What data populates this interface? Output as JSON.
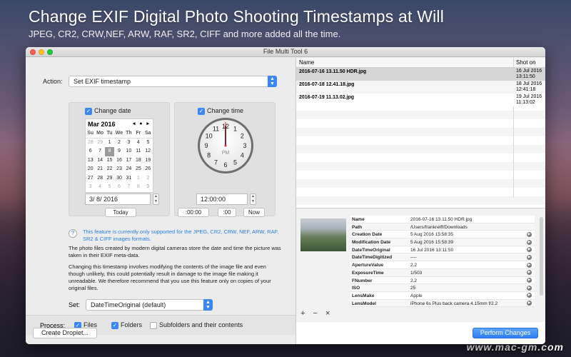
{
  "hero": {
    "title": "Change EXIF Digital Photo Shooting Timestamps at Will",
    "subtitle": "JPEG, CR2, CRW,NEF, ARW, RAF, SR2, CIFF and more added all the time."
  },
  "watermark": "www.mac-gm.com",
  "window": {
    "title": "File Multi Tool 6"
  },
  "action": {
    "label": "Action:",
    "value": "Set EXIF timestamp"
  },
  "date_panel": {
    "checkbox_label": "Change date",
    "month": "Mar 2016",
    "nav": "◂ ● ▸",
    "dow": [
      "Su",
      "Mo",
      "Tu",
      "We",
      "Th",
      "Fr",
      "Sa"
    ],
    "weeks": [
      [
        "28",
        "29",
        "1",
        "2",
        "3",
        "4",
        "5"
      ],
      [
        "6",
        "7",
        "8",
        "9",
        "10",
        "11",
        "12"
      ],
      [
        "13",
        "14",
        "15",
        "16",
        "17",
        "18",
        "19"
      ],
      [
        "20",
        "21",
        "22",
        "23",
        "24",
        "25",
        "26"
      ],
      [
        "27",
        "28",
        "29",
        "30",
        "31",
        "1",
        "2"
      ],
      [
        "3",
        "4",
        "5",
        "6",
        "7",
        "8",
        "9"
      ]
    ],
    "date_value": "3/  8/ 2016",
    "today_button": "Today"
  },
  "time_panel": {
    "checkbox_label": "Change time",
    "clock_numbers": [
      "12",
      "1",
      "2",
      "3",
      "4",
      "5",
      "6",
      "7",
      "8",
      "9",
      "10",
      "11"
    ],
    "pm_label": "PM",
    "time_value": "12:00:00",
    "btn_zero_min": ":00:00",
    "btn_zero_sec": ":00",
    "btn_now": "Now"
  },
  "info": {
    "help_icon": "?",
    "note": "This feature is currently only supported for the JPEG, CR2, CRW, NEF, ARW, RAF, SR2 & CIFF images formats.",
    "para1": "The photo files created by modern digital cameras store the date and time the picture was taken in their EXIF meta-data.",
    "para2": "Changing this timestamp involves modifying the contents of the image file and even though unlikely, this could potentially result in damage to the image file making it unreadable. We therefore recommend that you use this feature only on copies of your original files."
  },
  "set": {
    "label": "Set:",
    "value": "DateTimeOriginal (default)"
  },
  "process": {
    "label": "Process:",
    "files": "Files",
    "folders": "Folders",
    "subfolders": "Subfolders and their contents"
  },
  "buttons": {
    "create_droplet": "Create Droplet...",
    "perform": "Perform Changes"
  },
  "file_list": {
    "col_name": "Name",
    "col_shot": "Shot on",
    "rows": [
      {
        "name": "2016-07-16 13.11.50 HDR.jpg",
        "date": "16 Jul 2016",
        "time": "13:11:50"
      },
      {
        "name": "2016-07-18 12.41.18.jpg",
        "date": "18 Jul 2016",
        "time": "12:41:18"
      },
      {
        "name": "2016-07-19 11.13.02.jpg",
        "date": "19 Jul 2016",
        "time": "11:13:02"
      }
    ]
  },
  "details": {
    "rows": [
      {
        "key": "Name",
        "value": "2016-07-16 13.11.50 HDR.jpg",
        "arrow": false
      },
      {
        "key": "Path",
        "value": "/Users/frankreiff/Downloads",
        "arrow": false
      },
      {
        "key": "Creation Date",
        "value": "5 Aug 2016 15:58:35",
        "arrow": true
      },
      {
        "key": "Modification Date",
        "value": "5 Aug 2016 15:58:39",
        "arrow": true
      },
      {
        "key": "DateTimeOriginal",
        "value": "16 Jul 2016 13:11:50",
        "arrow": true
      },
      {
        "key": "DateTimeDigitized",
        "value": "----",
        "arrow": true
      },
      {
        "key": "ApertureValue",
        "value": "2.2",
        "arrow": true
      },
      {
        "key": "ExposureTime",
        "value": "1/503",
        "arrow": true
      },
      {
        "key": "FNumber",
        "value": "2.2",
        "arrow": true
      },
      {
        "key": "ISO",
        "value": "25",
        "arrow": true
      },
      {
        "key": "LensMake",
        "value": "Apple",
        "arrow": true
      },
      {
        "key": "LensModel",
        "value": "iPhone 6s Plus back camera 4.15mm f/2.2",
        "arrow": true
      }
    ],
    "tools": [
      "+",
      "−",
      "×"
    ]
  },
  "colors": {
    "accent": "#3b86f7",
    "selected_row": "#d5d5d5"
  }
}
